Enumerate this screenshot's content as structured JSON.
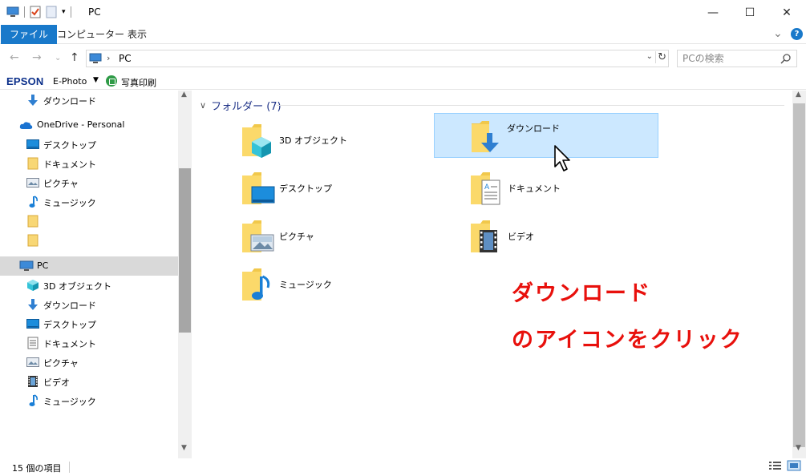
{
  "window": {
    "title": "PC",
    "buttons": {
      "minimize": "—",
      "maximize": "☐",
      "close": "✕"
    }
  },
  "ribbon": {
    "tabs": [
      "ファイル",
      "コンピューター",
      "表示"
    ],
    "expand": "⌄",
    "help": "?"
  },
  "address": {
    "location": "PC",
    "search_placeholder": "PCの検索"
  },
  "epson": {
    "logo": "EPSON",
    "ephoto": "E-Photo",
    "print_label": "写真印刷"
  },
  "nav": {
    "items": [
      {
        "label": "ダウンロード",
        "icon": "download-icon"
      },
      {
        "label": "OneDrive - Personal",
        "icon": "onedrive-cloud-icon"
      },
      {
        "label": "デスクトップ",
        "icon": "desktop-icon"
      },
      {
        "label": "ドキュメント",
        "icon": "document-icon"
      },
      {
        "label": "ピクチャ",
        "icon": "picture-icon"
      },
      {
        "label": "ミュージック",
        "icon": "music-icon"
      },
      {
        "label": "",
        "icon": "folder-icon"
      },
      {
        "label": "",
        "icon": "folder-icon"
      },
      {
        "label": "PC",
        "icon": "pc-icon"
      },
      {
        "label": "3D オブジェクト",
        "icon": "3d-objects-icon"
      },
      {
        "label": "ダウンロード",
        "icon": "download-icon"
      },
      {
        "label": "デスクトップ",
        "icon": "desktop-icon"
      },
      {
        "label": "ドキュメント",
        "icon": "document-icon"
      },
      {
        "label": "ピクチャ",
        "icon": "picture-icon"
      },
      {
        "label": "ビデオ",
        "icon": "video-icon"
      },
      {
        "label": "ミュージック",
        "icon": "music-icon"
      }
    ]
  },
  "content": {
    "group_header": "フォルダー (7)",
    "folders": [
      {
        "label": "3D オブジェクト",
        "icon": "3d-objects-folder-icon"
      },
      {
        "label": "ダウンロード",
        "icon": "download-folder-icon"
      },
      {
        "label": "デスクトップ",
        "icon": "desktop-folder-icon"
      },
      {
        "label": "ドキュメント",
        "icon": "document-folder-icon"
      },
      {
        "label": "ピクチャ",
        "icon": "picture-folder-icon"
      },
      {
        "label": "ビデオ",
        "icon": "video-folder-icon"
      },
      {
        "label": "ミュージック",
        "icon": "music-folder-icon"
      }
    ]
  },
  "annotation": {
    "line1": "ダウンロード",
    "line2": "のアイコンをクリック",
    "color": "#e8100c"
  },
  "status": {
    "count": "15 個の項目"
  },
  "colors": {
    "file_tab": "#1979ca",
    "selection": "#cce8ff",
    "group_header": "#1e3287"
  }
}
